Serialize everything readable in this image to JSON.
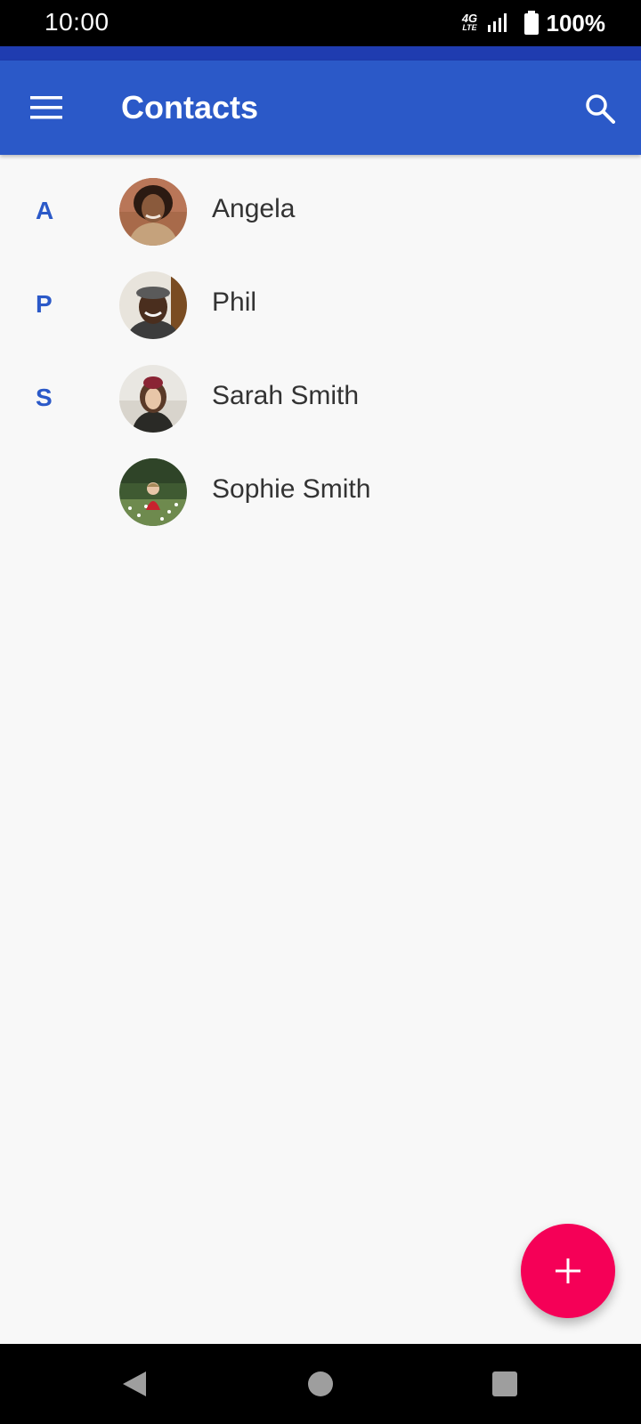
{
  "status_bar": {
    "time": "10:00",
    "network": "4G",
    "network_sub": "LTE",
    "battery": "100%"
  },
  "app_bar": {
    "title": "Contacts",
    "menu_icon": "hamburger-menu-icon",
    "search_icon": "search-icon"
  },
  "contacts": [
    {
      "letter": "A",
      "name": "Angela"
    },
    {
      "letter": "P",
      "name": "Phil"
    },
    {
      "letter": "S",
      "name": "Sarah Smith"
    },
    {
      "letter": "",
      "name": "Sophie Smith"
    }
  ],
  "fab": {
    "icon": "plus-icon"
  },
  "nav_bar": {
    "back_icon": "back-triangle-icon",
    "home_icon": "home-circle-icon",
    "recents_icon": "recents-square-icon"
  },
  "colors": {
    "primary": "#2b59c8",
    "primary_dark": "#1f3cb0",
    "accent": "#f50057",
    "background": "#f8f8f8"
  }
}
